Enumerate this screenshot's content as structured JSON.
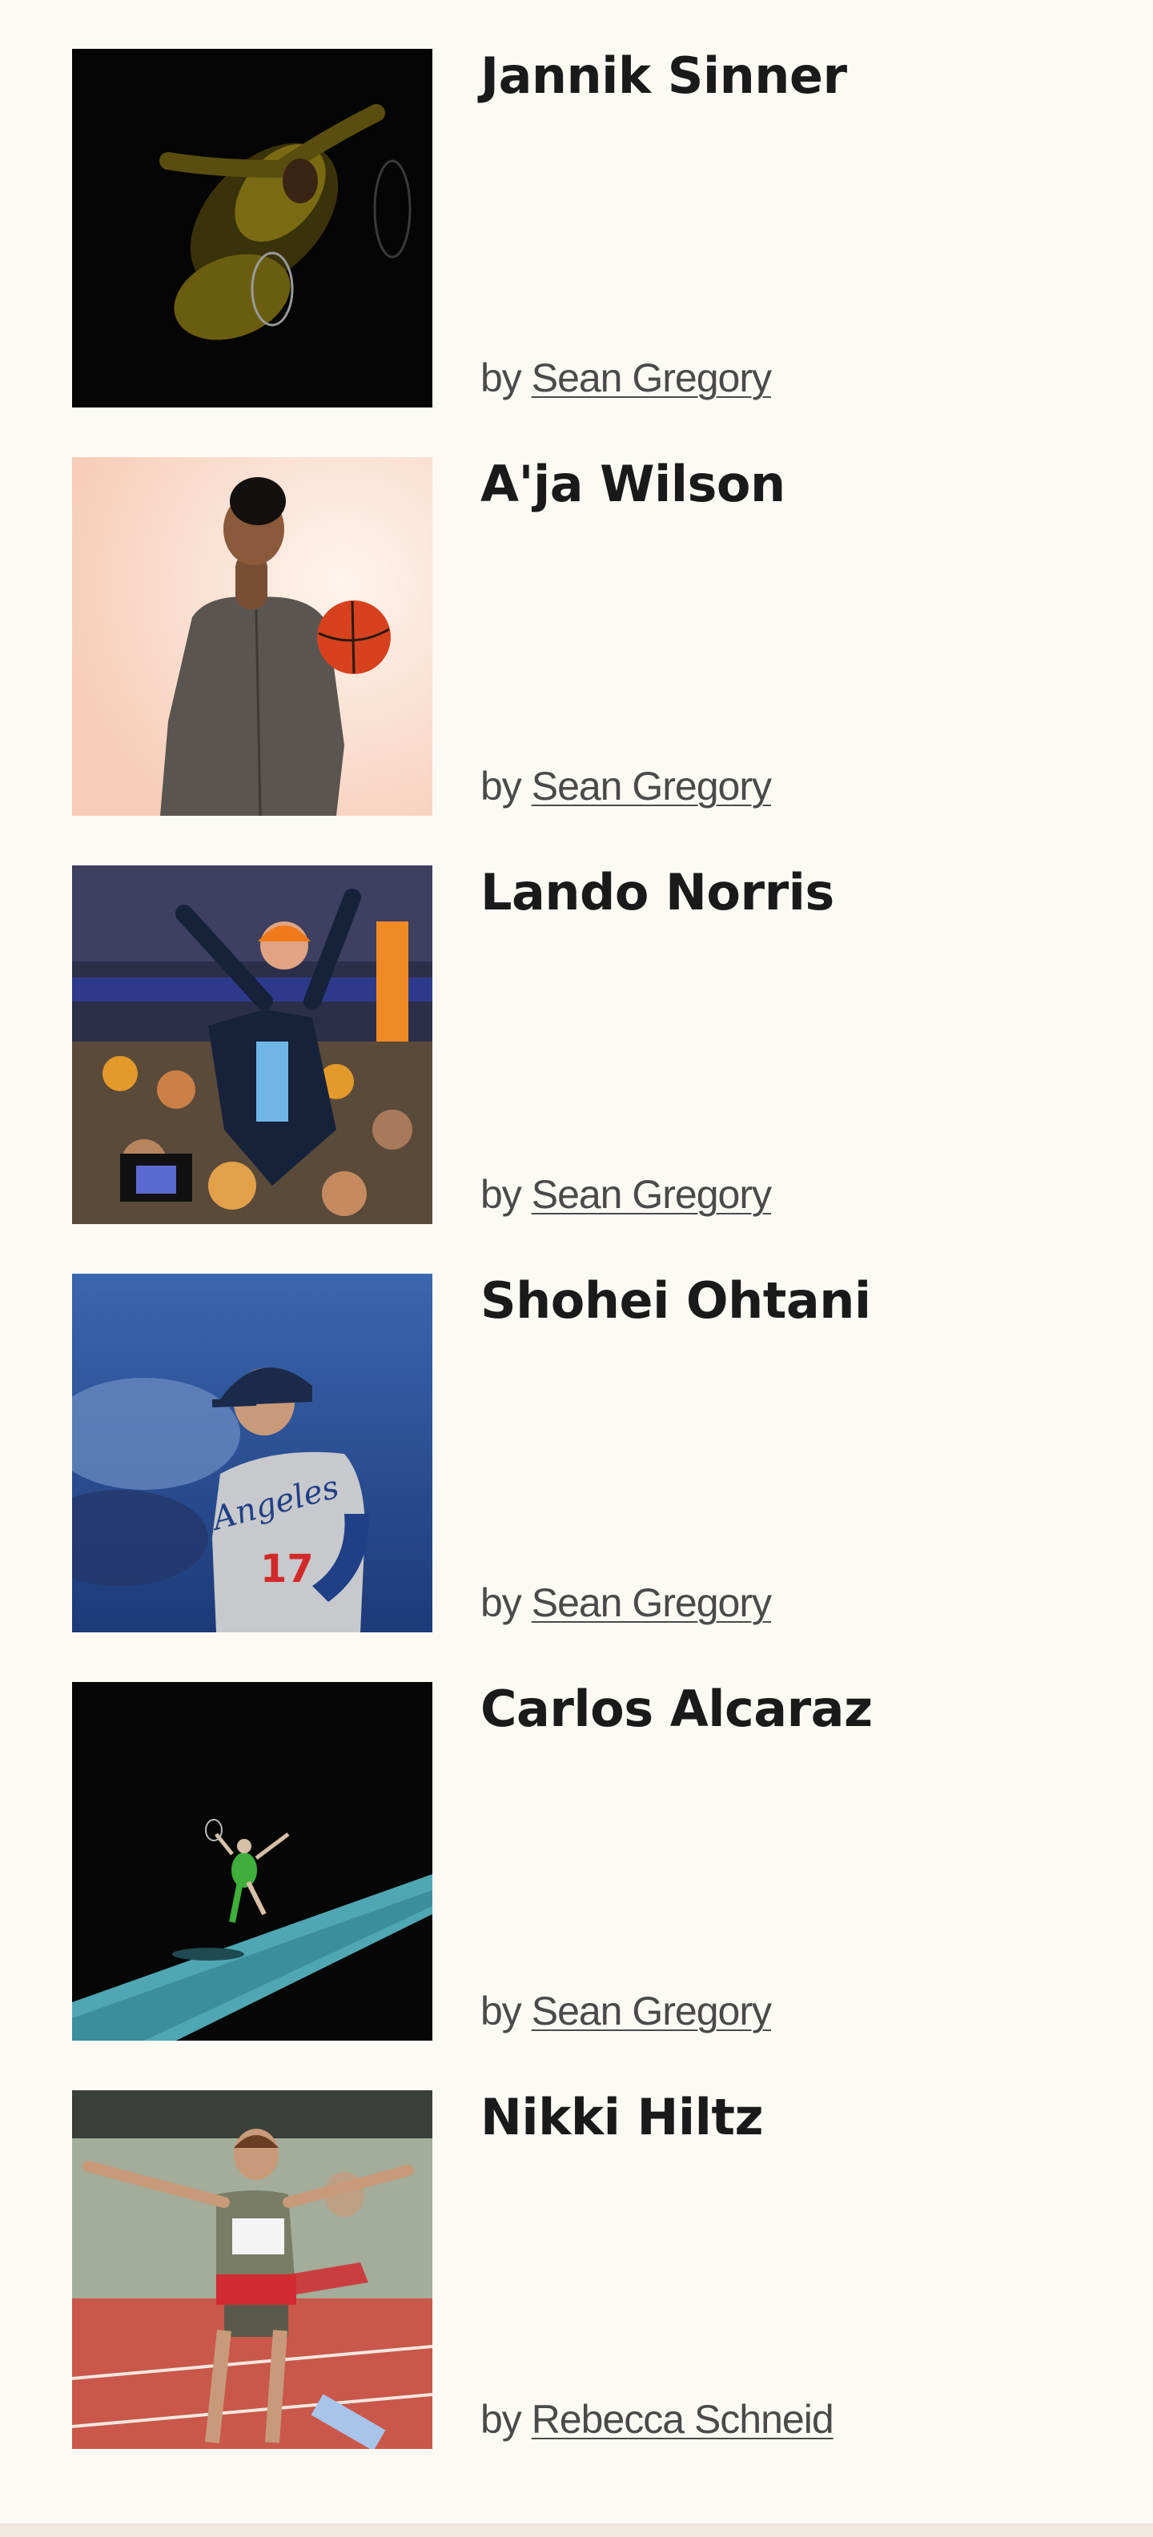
{
  "articles": [
    {
      "title": "Jannik Sinner",
      "by": "by",
      "author": "Sean Gregory",
      "image": "jannik-sinner-photo"
    },
    {
      "title": "A'ja Wilson",
      "by": "by",
      "author": "Sean Gregory",
      "image": "aja-wilson-photo"
    },
    {
      "title": "Lando Norris",
      "by": "by",
      "author": "Sean Gregory",
      "image": "lando-norris-photo"
    },
    {
      "title": "Shohei Ohtani",
      "by": "by",
      "author": "Sean Gregory",
      "image": "shohei-ohtani-photo"
    },
    {
      "title": "Carlos Alcaraz",
      "by": "by",
      "author": "Sean Gregory",
      "image": "carlos-alcaraz-photo"
    },
    {
      "title": "Nikki Hiltz",
      "by": "by",
      "author": "Rebecca Schneid",
      "image": "nikki-hiltz-photo"
    }
  ],
  "colors": {
    "background": "#fdfaf6",
    "title": "#1a1a1a",
    "byline": "#4a4a4a"
  }
}
